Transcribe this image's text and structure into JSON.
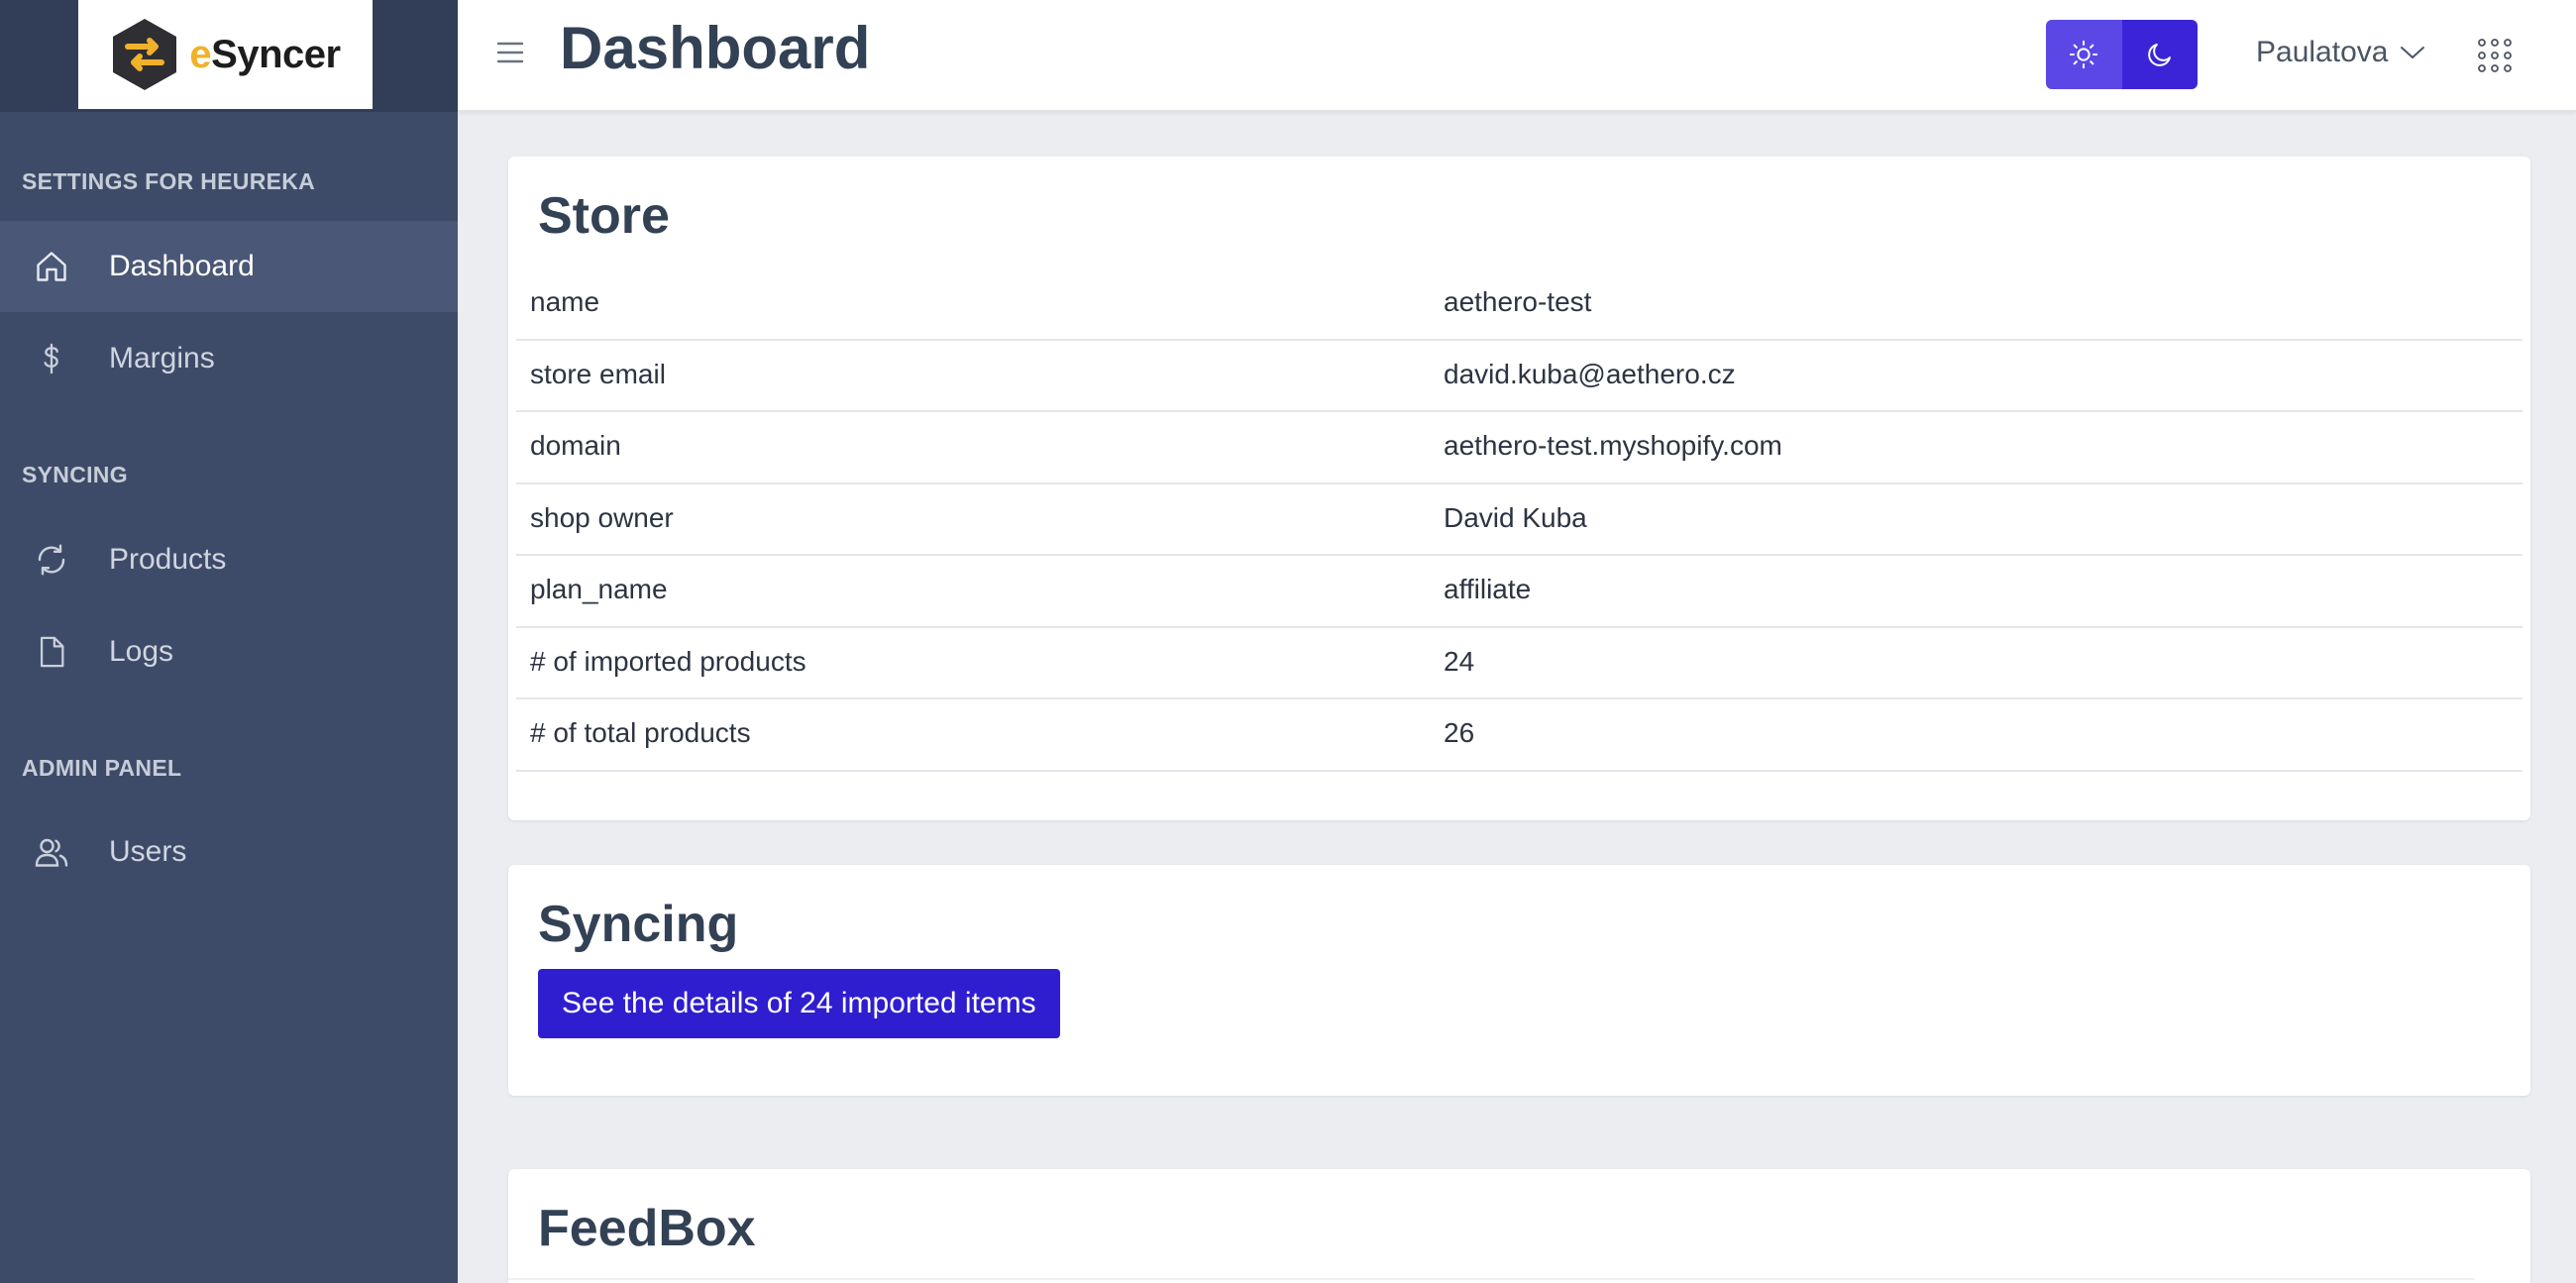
{
  "brand": {
    "logo_text_accent": "e",
    "logo_text_rest": "Syncer"
  },
  "sidebar": {
    "sections": [
      {
        "title": "SETTINGS FOR HEUREKA"
      },
      {
        "title": "SYNCING"
      },
      {
        "title": "ADMIN PANEL"
      }
    ],
    "items": [
      {
        "label": "Dashboard",
        "icon": "home-icon",
        "active": true
      },
      {
        "label": "Margins",
        "icon": "dollar-icon"
      },
      {
        "label": "Products",
        "icon": "sync-icon"
      },
      {
        "label": "Logs",
        "icon": "file-icon"
      },
      {
        "label": "Users",
        "icon": "users-icon"
      }
    ]
  },
  "header": {
    "title": "Dashboard",
    "user_name": "Paulatova"
  },
  "store": {
    "title": "Store",
    "rows": [
      {
        "key": "name",
        "value": "aethero-test"
      },
      {
        "key": "store email",
        "value": "david.kuba@aethero.cz"
      },
      {
        "key": "domain",
        "value": "aethero-test.myshopify.com"
      },
      {
        "key": "shop owner",
        "value": "David Kuba"
      },
      {
        "key": "plan_name",
        "value": "affiliate"
      },
      {
        "key": "# of imported products",
        "value": "24"
      },
      {
        "key": "# of total products",
        "value": "26"
      }
    ]
  },
  "syncing": {
    "title": "Syncing",
    "button_label": "See the details of 24 imported items"
  },
  "feedbox": {
    "title": "FeedBox"
  },
  "colors": {
    "sidebar_bg": "#3e4b68",
    "sidebar_active": "#4a5776",
    "primary": "#2f1ed0",
    "logo_accent": "#f0b12b"
  }
}
